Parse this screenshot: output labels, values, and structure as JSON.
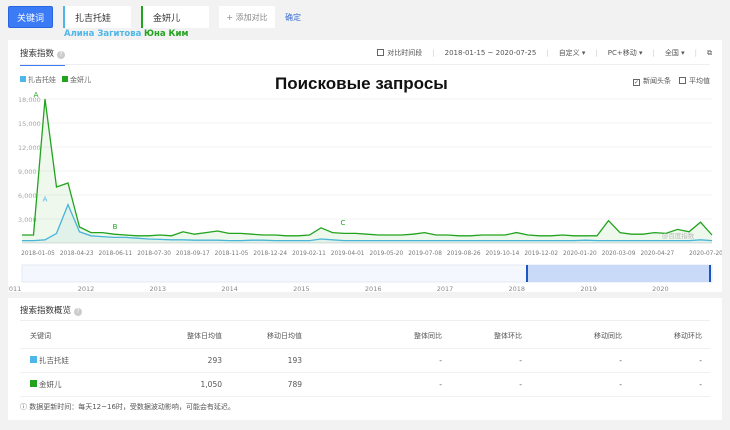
{
  "top": {
    "keyword_button": "关键词",
    "keywords": [
      {
        "label": "扎吉托娃",
        "caption": "Алина Загитова",
        "color": "#4fb7e8"
      },
      {
        "label": "金妍儿",
        "caption": "Юна Ким",
        "color": "#22a31e"
      }
    ],
    "add_compare": "+ 添加对比",
    "confirm": "确定"
  },
  "search_index": {
    "title": "搜索指数",
    "help": "?",
    "compare_period": "对比时间段",
    "date_range": "2018-01-15 ~ 2020-07-25",
    "custom": "自定义",
    "device": "PC+移动",
    "region": "全国",
    "news": "新闻头条",
    "average": "平均值",
    "overlay_title": "Поисковые запросы",
    "watermark": "@百度指数"
  },
  "chart_data": {
    "type": "line",
    "title": "Поисковые запросы",
    "yticks": [
      "3,000",
      "6,000",
      "9,000",
      "12,000",
      "15,000",
      "18,000"
    ],
    "ylim": [
      0,
      18000
    ],
    "xticks": [
      "2018-01-05",
      "2018-04-23",
      "2018-06-11",
      "2018-07-30",
      "2018-09-17",
      "2018-11-05",
      "2018-12-24",
      "2019-02-11",
      "2019-04-01",
      "2019-05-20",
      "2019-07-08",
      "2019-08-26",
      "2019-10-14",
      "2019-12-02",
      "2020-01-20",
      "2020-03-09",
      "2020-04-27",
      "2020-07-20"
    ],
    "annotations": [
      "A",
      "A",
      "B",
      "C"
    ],
    "series": [
      {
        "name": "扎吉托娃",
        "color": "#4fb7e8",
        "values": [
          300,
          300,
          400,
          1200,
          4800,
          1400,
          900,
          800,
          700,
          700,
          600,
          500,
          450,
          400,
          400,
          350,
          350,
          350,
          300,
          300,
          350,
          350,
          300,
          300,
          300,
          300,
          500,
          400,
          300,
          300,
          300,
          300,
          300,
          300,
          300,
          300,
          300,
          300,
          300,
          300,
          300,
          300,
          300,
          300,
          300,
          300,
          300,
          300,
          300,
          350,
          300,
          300,
          300,
          300,
          300,
          300,
          300,
          300,
          300,
          400,
          300
        ]
      },
      {
        "name": "金妍儿",
        "color": "#22a31e",
        "values": [
          1000,
          1000,
          18000,
          7000,
          7500,
          2000,
          1300,
          1300,
          1100,
          1000,
          900,
          900,
          1000,
          900,
          1400,
          1100,
          1300,
          1500,
          1200,
          1200,
          1100,
          1000,
          1000,
          900,
          900,
          1000,
          1900,
          1300,
          1200,
          1200,
          1100,
          1000,
          1000,
          1000,
          1100,
          1300,
          1000,
          1000,
          900,
          900,
          1000,
          1000,
          1000,
          1300,
          1000,
          900,
          900,
          1000,
          900,
          900,
          900,
          2800,
          1300,
          1100,
          1100,
          1300,
          1200,
          1700,
          1400,
          2600,
          1000
        ]
      }
    ]
  },
  "timeline": {
    "years": [
      "2011",
      "2012",
      "2013",
      "2014",
      "2015",
      "2016",
      "2017",
      "2018",
      "2019",
      "2020"
    ]
  },
  "overview": {
    "title": "搜索指数概览",
    "headers": [
      "关键词",
      "整体日均值",
      "移动日均值",
      "整体同比",
      "整体环比",
      "移动同比",
      "移动环比"
    ],
    "rows": [
      {
        "keyword": "扎吉托娃",
        "color": "#4fb7e8",
        "overall": "293",
        "mobile": "193",
        "c1": "-",
        "c2": "-",
        "c3": "-",
        "c4": "-"
      },
      {
        "keyword": "金妍儿",
        "color": "#22a31e",
        "overall": "1,050",
        "mobile": "789",
        "c1": "-",
        "c2": "-",
        "c3": "-",
        "c4": "-"
      }
    ],
    "note": "ⓘ 数据更新时间：每天12~16时，受数据波动影响，可能会有延迟。"
  }
}
